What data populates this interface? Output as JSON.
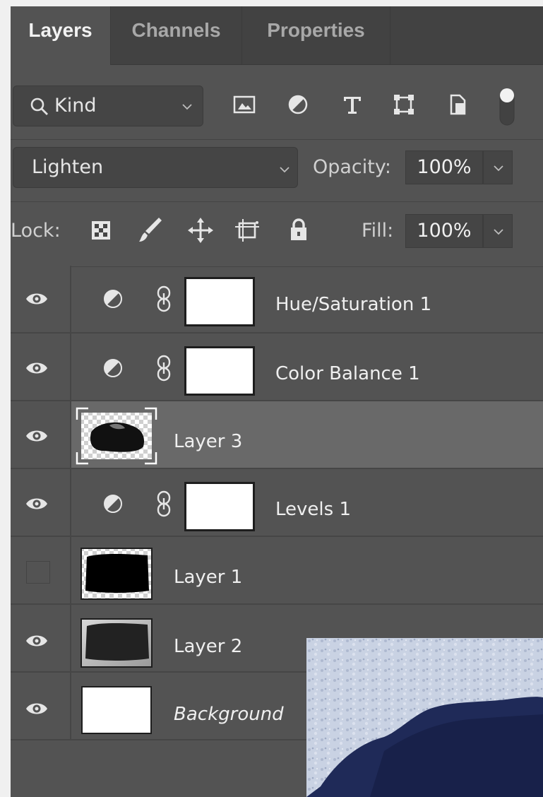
{
  "tabs": [
    "Layers",
    "Channels",
    "Properties"
  ],
  "filter": {
    "kind_label": "Kind",
    "icons": [
      "image-filter-icon",
      "adjustment-filter-icon",
      "type-filter-icon",
      "shape-filter-icon",
      "smart-object-filter-icon"
    ]
  },
  "blend": {
    "mode": "Lighten",
    "opacity_label": "Opacity:",
    "opacity_value": "100%"
  },
  "lock": {
    "label": "Lock:",
    "fill_label": "Fill:",
    "fill_value": "100%"
  },
  "layers": [
    {
      "name": "Hue/Saturation 1",
      "visible": true,
      "kind": "adjustment"
    },
    {
      "name": "Color Balance 1",
      "visible": true,
      "kind": "adjustment"
    },
    {
      "name": "Layer 3",
      "visible": true,
      "kind": "pixel",
      "selected": true
    },
    {
      "name": "Levels 1",
      "visible": true,
      "kind": "adjustment"
    },
    {
      "name": "Layer 1",
      "visible": false,
      "kind": "pixel"
    },
    {
      "name": "Layer 2",
      "visible": true,
      "kind": "pixel"
    },
    {
      "name": "Background",
      "visible": true,
      "kind": "background"
    }
  ],
  "colors": {
    "panel": "#535353",
    "tabbar": "#424242",
    "selected": "#696969",
    "text": "#efefef"
  }
}
